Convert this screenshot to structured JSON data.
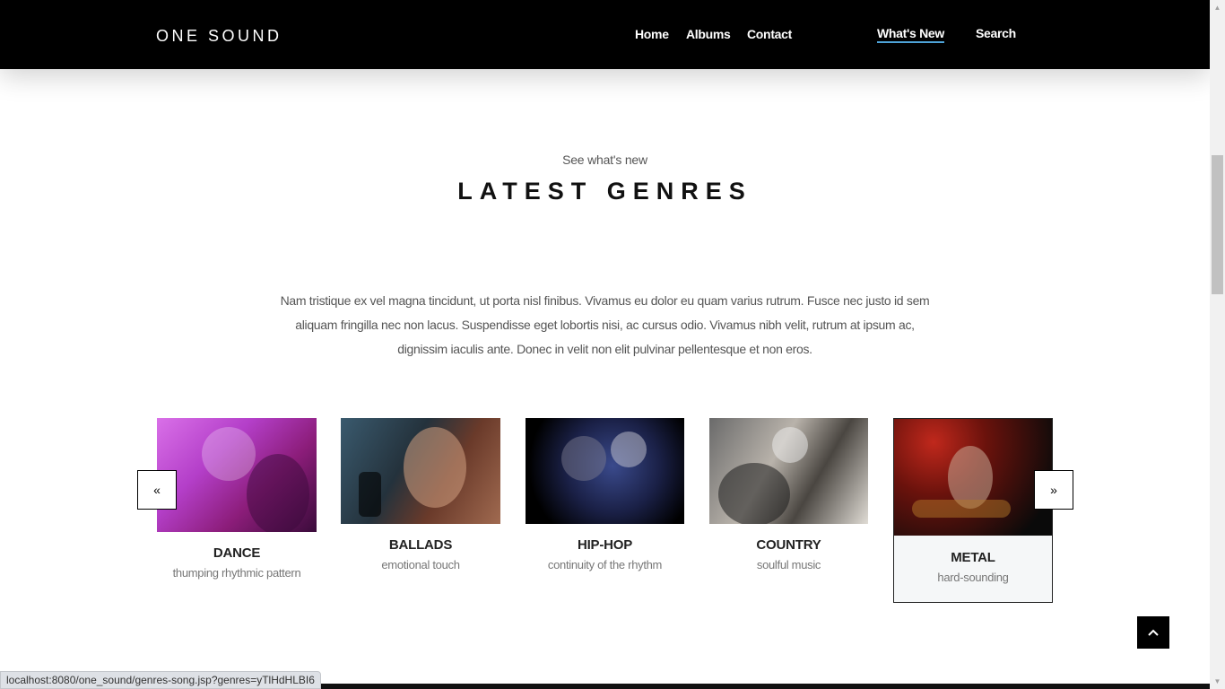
{
  "header": {
    "brand": "ONE SOUND",
    "nav": [
      {
        "label": "Home"
      },
      {
        "label": "Albums"
      },
      {
        "label": "Contact"
      },
      {
        "label": "What's New",
        "active": true
      },
      {
        "label": "Search"
      }
    ]
  },
  "section": {
    "kicker": "See what's new",
    "title": "LATEST GENRES",
    "intro": "Nam tristique ex vel magna tincidunt, ut porta nisl finibus. Vivamus eu dolor eu quam varius rutrum. Fusce nec justo id sem aliquam fringilla nec non lacus. Suspendisse eget lobortis nisi, ac cursus odio. Vivamus nibh velit, rutrum at ipsum ac, dignissim iaculis ante. Donec in velit non elit pulvinar pellentesque et non eros."
  },
  "genres": [
    {
      "name": "DANCE",
      "desc": "thumping rhythmic pattern"
    },
    {
      "name": "BALLADS",
      "desc": "emotional touch"
    },
    {
      "name": "HIP-HOP",
      "desc": "continuity of the rhythm"
    },
    {
      "name": "COUNTRY",
      "desc": "soulful music"
    },
    {
      "name": "METAL",
      "desc": "hard-sounding",
      "active": true
    }
  ],
  "slider": {
    "prev_icon": "«",
    "next_icon": "»"
  },
  "status_bar": {
    "url": "localhost:8080/one_sound/genres-song.jsp?genres=yTlHdHLBI6"
  },
  "colors": {
    "header_bg": "#000000",
    "active_underline": "#4ea3d8",
    "card_active_bg": "#f5f7f8"
  }
}
